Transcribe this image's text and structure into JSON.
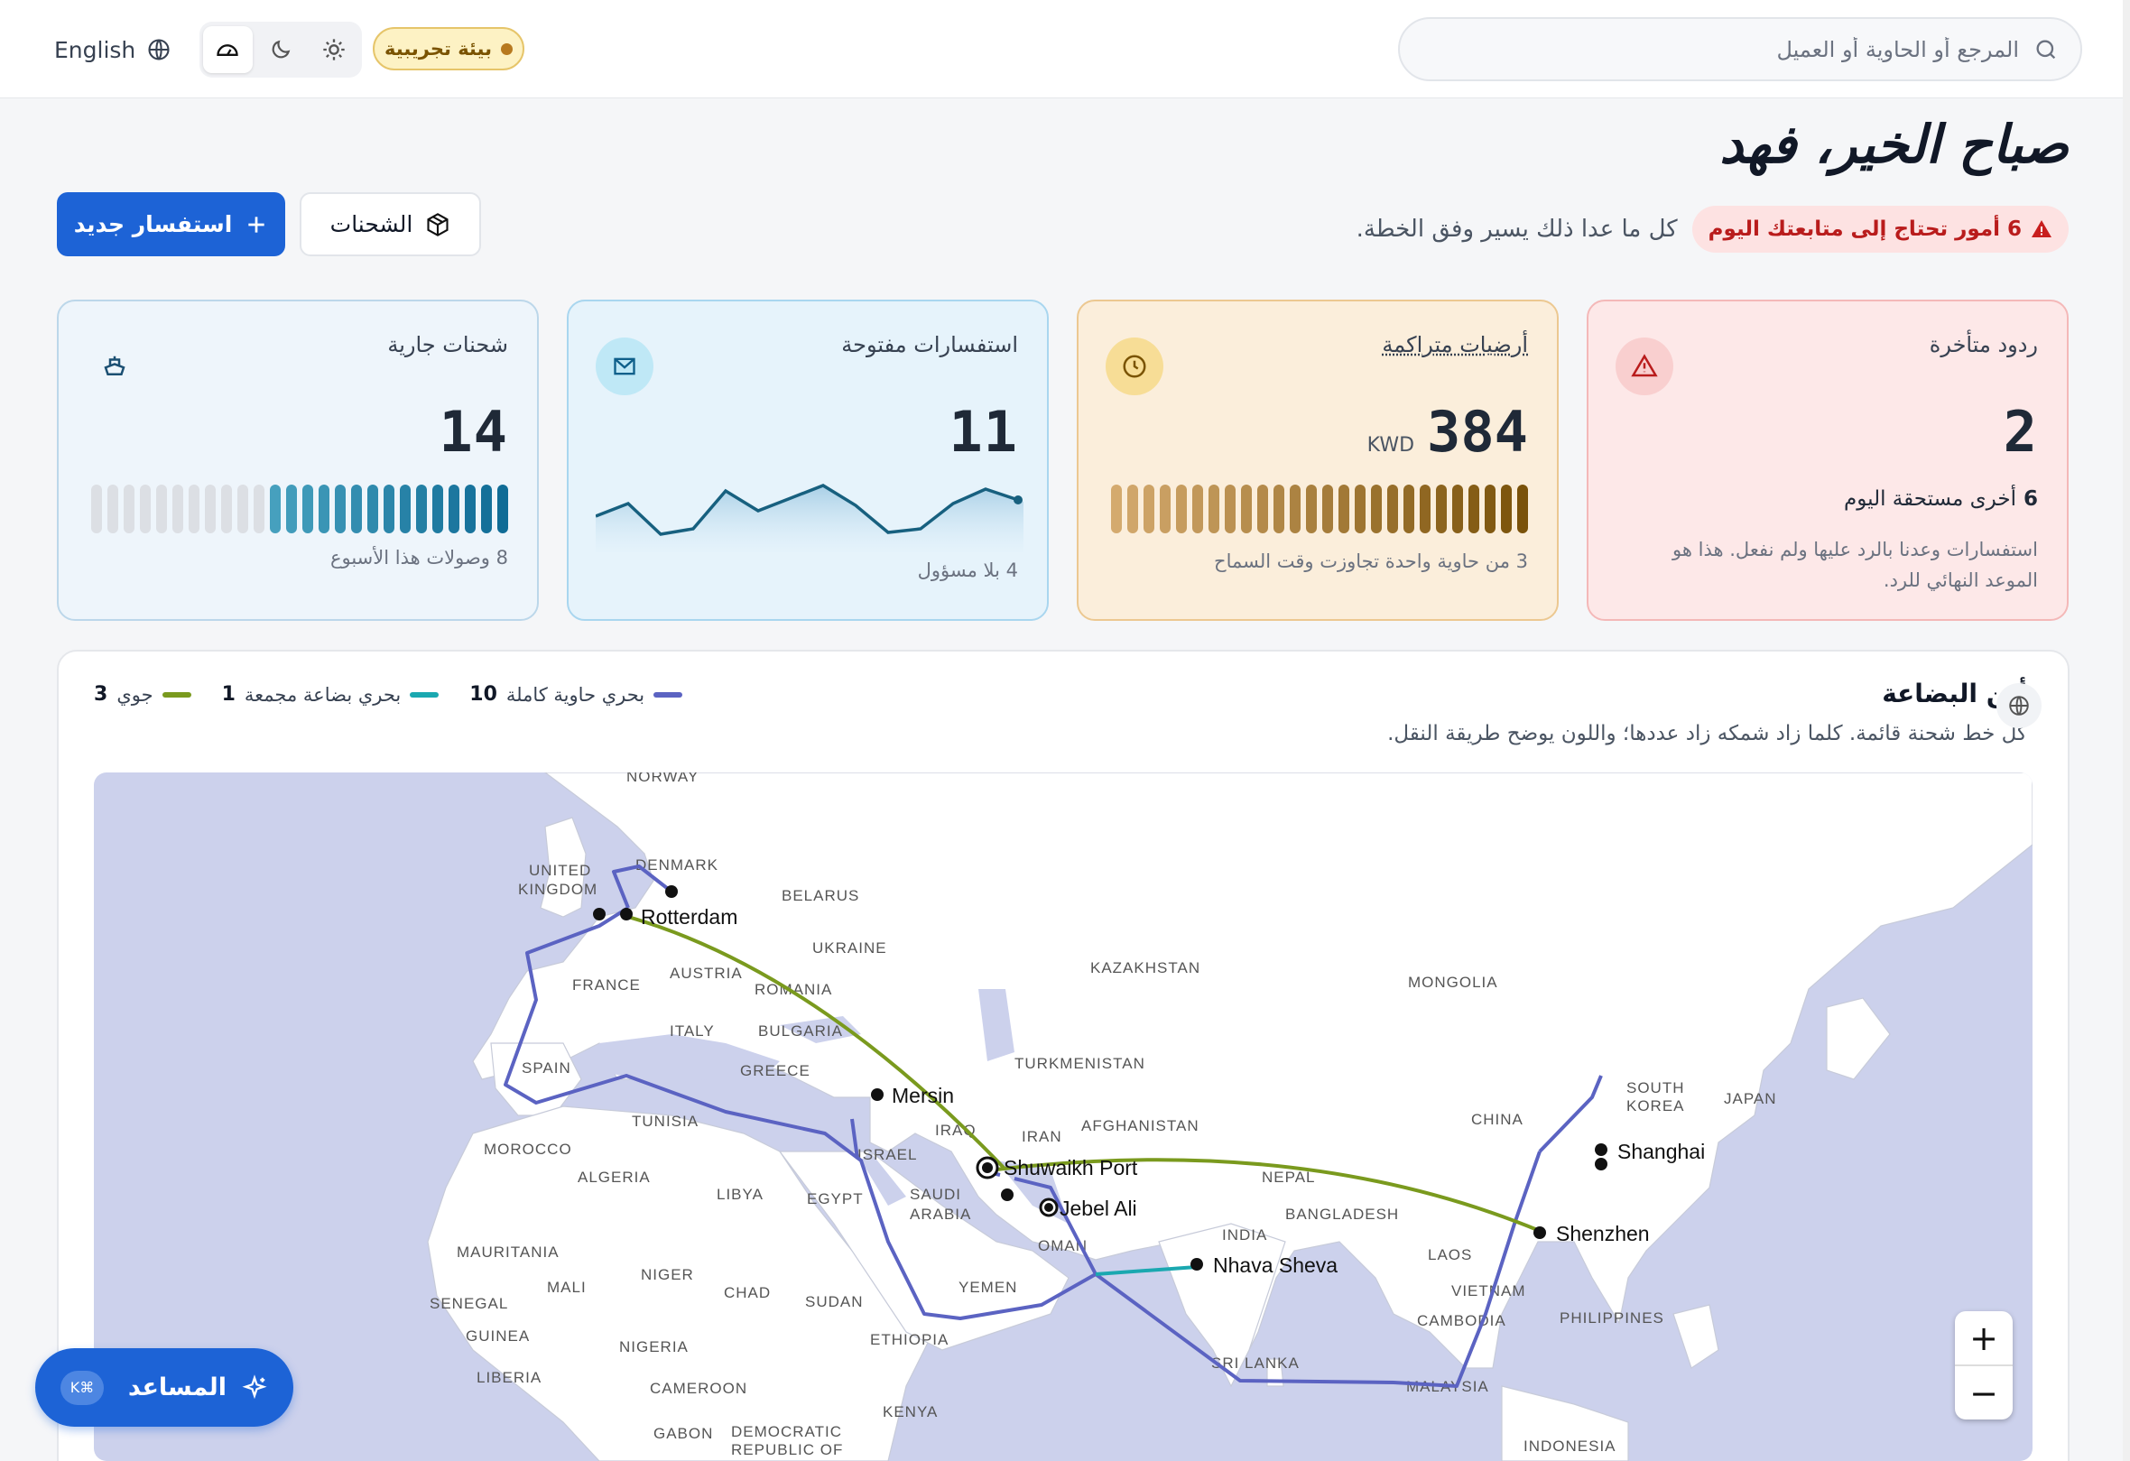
{
  "header": {
    "search_placeholder": "المرجع أو الحاوية أو العميل",
    "env_badge": "بيئة تجريبية",
    "language": "English"
  },
  "greeting": {
    "title": "صباح الخير، فهد",
    "alert": "6 أمور تحتاج إلى متابعتك اليوم",
    "rest": "كل ما عدا ذلك يسير وفق الخطة."
  },
  "actions": {
    "new_inquiry": "استفسار جديد",
    "shipments": "الشحنات"
  },
  "cards": {
    "late": {
      "title": "ردود متأخرة",
      "value": "2",
      "sub_count": "6",
      "sub_label": "أخرى مستحقة اليوم",
      "note": "استفسارات وعدنا بالرد عليها ولم نفعل. هذا هو الموعد النهائي للرد."
    },
    "demurrage": {
      "title": "أرضيات متراكمة",
      "value": "384",
      "unit": "KWD",
      "foot": "3 من حاوية واحدة تجاوزت وقت السماح"
    },
    "inquiries": {
      "title": "استفسارات مفتوحة",
      "value": "11",
      "foot": "4 بلا مسؤول"
    },
    "shipments": {
      "title": "شحنات جارية",
      "value": "14",
      "foot": "8 وصولات هذا الأسبوع"
    }
  },
  "map_panel": {
    "title": "أين البضاعة",
    "subtitle": "كل خط شحنة قائمة. كلما زاد شمكه زاد عددها؛ واللون يوضح طريقة النقل.",
    "legend": [
      {
        "label": "بحري حاوية كاملة",
        "count": "10",
        "color": "#5b63c2"
      },
      {
        "label": "بحري بضاعة مجمعة",
        "count": "1",
        "color": "#1aa8b0"
      },
      {
        "label": "جوي",
        "count": "3",
        "color": "#7a9a1e"
      }
    ],
    "ports": [
      "Rotterdam",
      "Mersin",
      "Shuwaikh Port",
      "Jebel Ali",
      "Nhava Sheva",
      "Shanghai",
      "Shenzhen"
    ],
    "countries": [
      "NORWAY",
      "UNITED",
      "KINGDOM",
      "DENMARK",
      "BELARUS",
      "UKRAINE",
      "FRANCE",
      "AUSTRIA",
      "ROMANIA",
      "ITALY",
      "BULGARIA",
      "SPAIN",
      "GREECE",
      "TUNISIA",
      "MOROCCO",
      "ALGERIA",
      "LIBYA",
      "EGYPT",
      "ISRAEL",
      "IRAQ",
      "IRAN",
      "SAUDI",
      "ARABIA",
      "OMAN",
      "YEMEN",
      "KAZAKHSTAN",
      "TURKMENISTAN",
      "AFGHANISTAN",
      "MONGOLIA",
      "CHINA",
      "NEPAL",
      "BANGLADESH",
      "INDIA",
      "SOUTH",
      "KOREA",
      "JAPAN",
      "LAOS",
      "VIETNAM",
      "CAMBODIA",
      "PHILIPPINES",
      "SRI LANKA",
      "MALAYSIA",
      "INDONESIA",
      "MAURITANIA",
      "MALI",
      "NIGER",
      "CHAD",
      "SUDAN",
      "SENEGAL",
      "GUINEA",
      "NIGERIA",
      "ETHIOPIA",
      "LIBERIA",
      "CAMEROON",
      "GABON",
      "DEMOCRATIC",
      "REPUBLIC OF",
      "KENYA"
    ]
  },
  "assistant": {
    "label": "المساعد",
    "shortcut": "⌘K"
  },
  "colors": {
    "primary": "#1d63d6",
    "sea_fcl": "#5b63c2",
    "sea_lcl": "#1aa8b0",
    "air": "#7a9a1e"
  }
}
